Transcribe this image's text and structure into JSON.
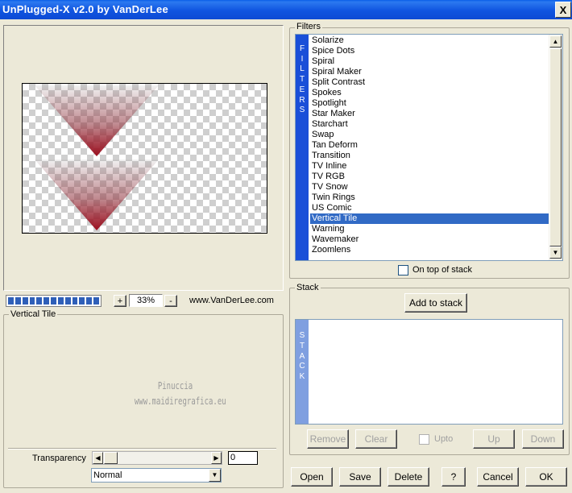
{
  "window": {
    "title": "UnPlugged-X v2.0 by VanDerLee",
    "close_label": "X"
  },
  "preview": {
    "zoom": {
      "minus_label": "-",
      "plus_label": "+",
      "value": "33%"
    },
    "progress": {
      "fraction": 1.0
    },
    "website": "www.VanDerLee.com"
  },
  "settings": {
    "title": "Vertical Tile",
    "watermark": [
      "Pinuccia",
      "www.maidiregrafica.eu"
    ],
    "transparency": {
      "label": "Transparency",
      "value": "0"
    },
    "blend_mode": {
      "selected": "Normal"
    }
  },
  "filters": {
    "group_label": "Filters",
    "band_text": [
      "F",
      "I",
      "L",
      "T",
      "E",
      "R",
      "S"
    ],
    "items": [
      "Solarize",
      "Spice Dots",
      "Spiral",
      "Spiral Maker",
      "Split Contrast",
      "Spokes",
      "Spotlight",
      "Star Maker",
      "Starchart",
      "Swap",
      "Tan Deform",
      "Transition",
      "TV Inline",
      "TV RGB",
      "TV Snow",
      "Twin Rings",
      "US Comic",
      "Vertical Tile",
      "Warning",
      "Wavemaker",
      "Zoomlens"
    ],
    "selected": "Vertical Tile",
    "on_top_label": "On top of stack"
  },
  "stack": {
    "group_label": "Stack",
    "band_text": [
      "S",
      "T",
      "A",
      "C",
      "K"
    ],
    "add_label": "Add to stack",
    "remove_label": "Remove",
    "clear_label": "Clear",
    "upto_label": "Upto",
    "up_label": "Up",
    "down_label": "Down"
  },
  "footer": {
    "open_label": "Open",
    "save_label": "Save",
    "delete_label": "Delete",
    "help_label": "?",
    "cancel_label": "Cancel",
    "ok_label": "OK"
  },
  "colors": {
    "titlebar": "#0d4ad4",
    "selection": "#316ac5",
    "filters_band": "#1a4fd8",
    "stack_band": "#7f9fe0",
    "shape": "#9c1020"
  }
}
